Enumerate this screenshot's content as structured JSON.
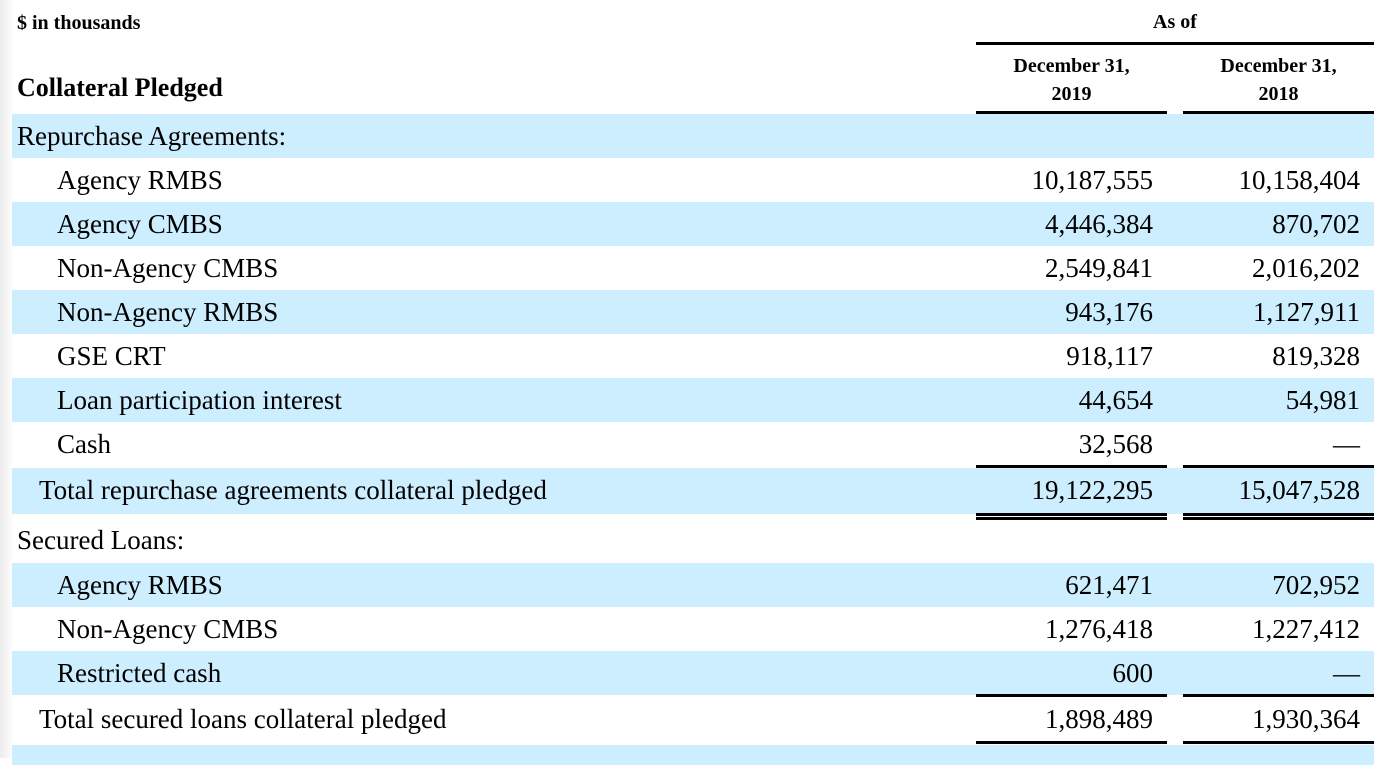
{
  "header": {
    "units": "$ in thousands",
    "as_of": "As of",
    "columns": [
      {
        "line1": "December 31,",
        "line2": "2019"
      },
      {
        "line1": "December 31,",
        "line2": "2018"
      }
    ],
    "section_title": "Collateral Pledged"
  },
  "rows": [
    {
      "label": "Repurchase Agreements:",
      "v2019": "",
      "v2018": ""
    },
    {
      "label": "Agency RMBS",
      "v2019": "10,187,555",
      "v2018": "10,158,404"
    },
    {
      "label": "Agency CMBS",
      "v2019": "4,446,384",
      "v2018": "870,702"
    },
    {
      "label": "Non-Agency CMBS",
      "v2019": "2,549,841",
      "v2018": "2,016,202"
    },
    {
      "label": "Non-Agency RMBS",
      "v2019": "943,176",
      "v2018": "1,127,911"
    },
    {
      "label": "GSE CRT",
      "v2019": "918,117",
      "v2018": "819,328"
    },
    {
      "label": "Loan participation interest",
      "v2019": "44,654",
      "v2018": "54,981"
    },
    {
      "label": "Cash",
      "v2019": "32,568",
      "v2018": "—"
    },
    {
      "label": "Total repurchase agreements collateral pledged",
      "v2019": "19,122,295",
      "v2018": "15,047,528"
    },
    {
      "label": "Secured Loans:",
      "v2019": "",
      "v2018": ""
    },
    {
      "label": "Agency RMBS",
      "v2019": "621,471",
      "v2018": "702,952"
    },
    {
      "label": "Non-Agency CMBS",
      "v2019": "1,276,418",
      "v2018": "1,227,412"
    },
    {
      "label": "Restricted cash",
      "v2019": "600",
      "v2018": "—"
    },
    {
      "label": "Total secured loans collateral pledged",
      "v2019": "1,898,489",
      "v2018": "1,930,364"
    }
  ],
  "colors": {
    "row_shade": "#cceeff",
    "text": "#000000"
  }
}
